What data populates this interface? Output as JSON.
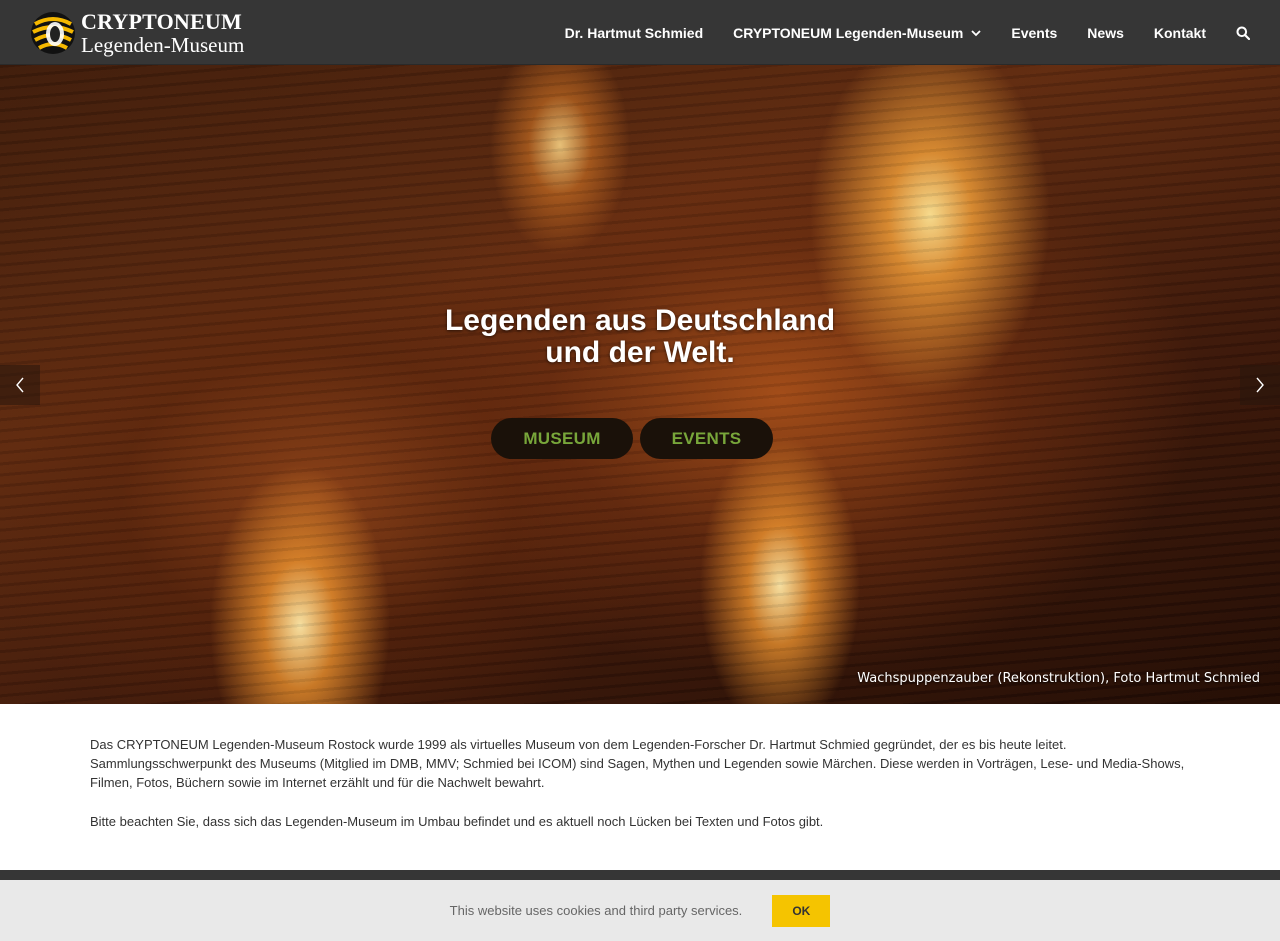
{
  "brand": {
    "line1": "CRYPTONEUM",
    "line2": "Legenden-Museum",
    "logo_icon": "flame-stripes-logo"
  },
  "nav": {
    "items": [
      {
        "label": "Dr. Hartmut Schmied"
      },
      {
        "label": "CRYPTONEUM Legenden-Museum",
        "has_dropdown": true
      },
      {
        "label": "Events"
      },
      {
        "label": "News"
      },
      {
        "label": "Kontakt"
      }
    ],
    "search_icon": "search-icon"
  },
  "hero": {
    "title_line1": "Legenden aus Deutschland",
    "title_line2": "und der Welt.",
    "button_museum": "MUSEUM",
    "button_events": "EVENTS",
    "caption": "Wachspuppenzauber (Rekonstruktion), Foto Hartmut Schmied",
    "prev_icon": "chevron-left-icon",
    "next_icon": "chevron-right-icon"
  },
  "content": {
    "paragraph1": "Das CRYPTONEUM Legenden-Museum Rostock wurde 1999 als virtuelles Museum von dem Legenden-Forscher Dr. Hartmut Schmied gegründet, der es bis heute leitet. Sammlungsschwerpunkt des Museums (Mitglied im DMB, MMV; Schmied bei ICOM) sind Sagen, Mythen und Legenden sowie Märchen. Diese werden in Vorträgen, Lese- und Media-Shows, Filmen, Fotos, Büchern sowie im Internet erzählt und für die Nachwelt bewahrt.",
    "paragraph2": "Bitte beachten Sie, dass sich das Legenden-Museum im Umbau befindet und es aktuell noch Lücken bei Texten und Fotos gibt."
  },
  "cookie": {
    "text": "This website uses cookies and third party services.",
    "ok_label": "OK"
  },
  "colors": {
    "header_bg": "#363636",
    "hero_button_text": "#78a63a",
    "cookie_ok_bg": "#f5c400"
  }
}
